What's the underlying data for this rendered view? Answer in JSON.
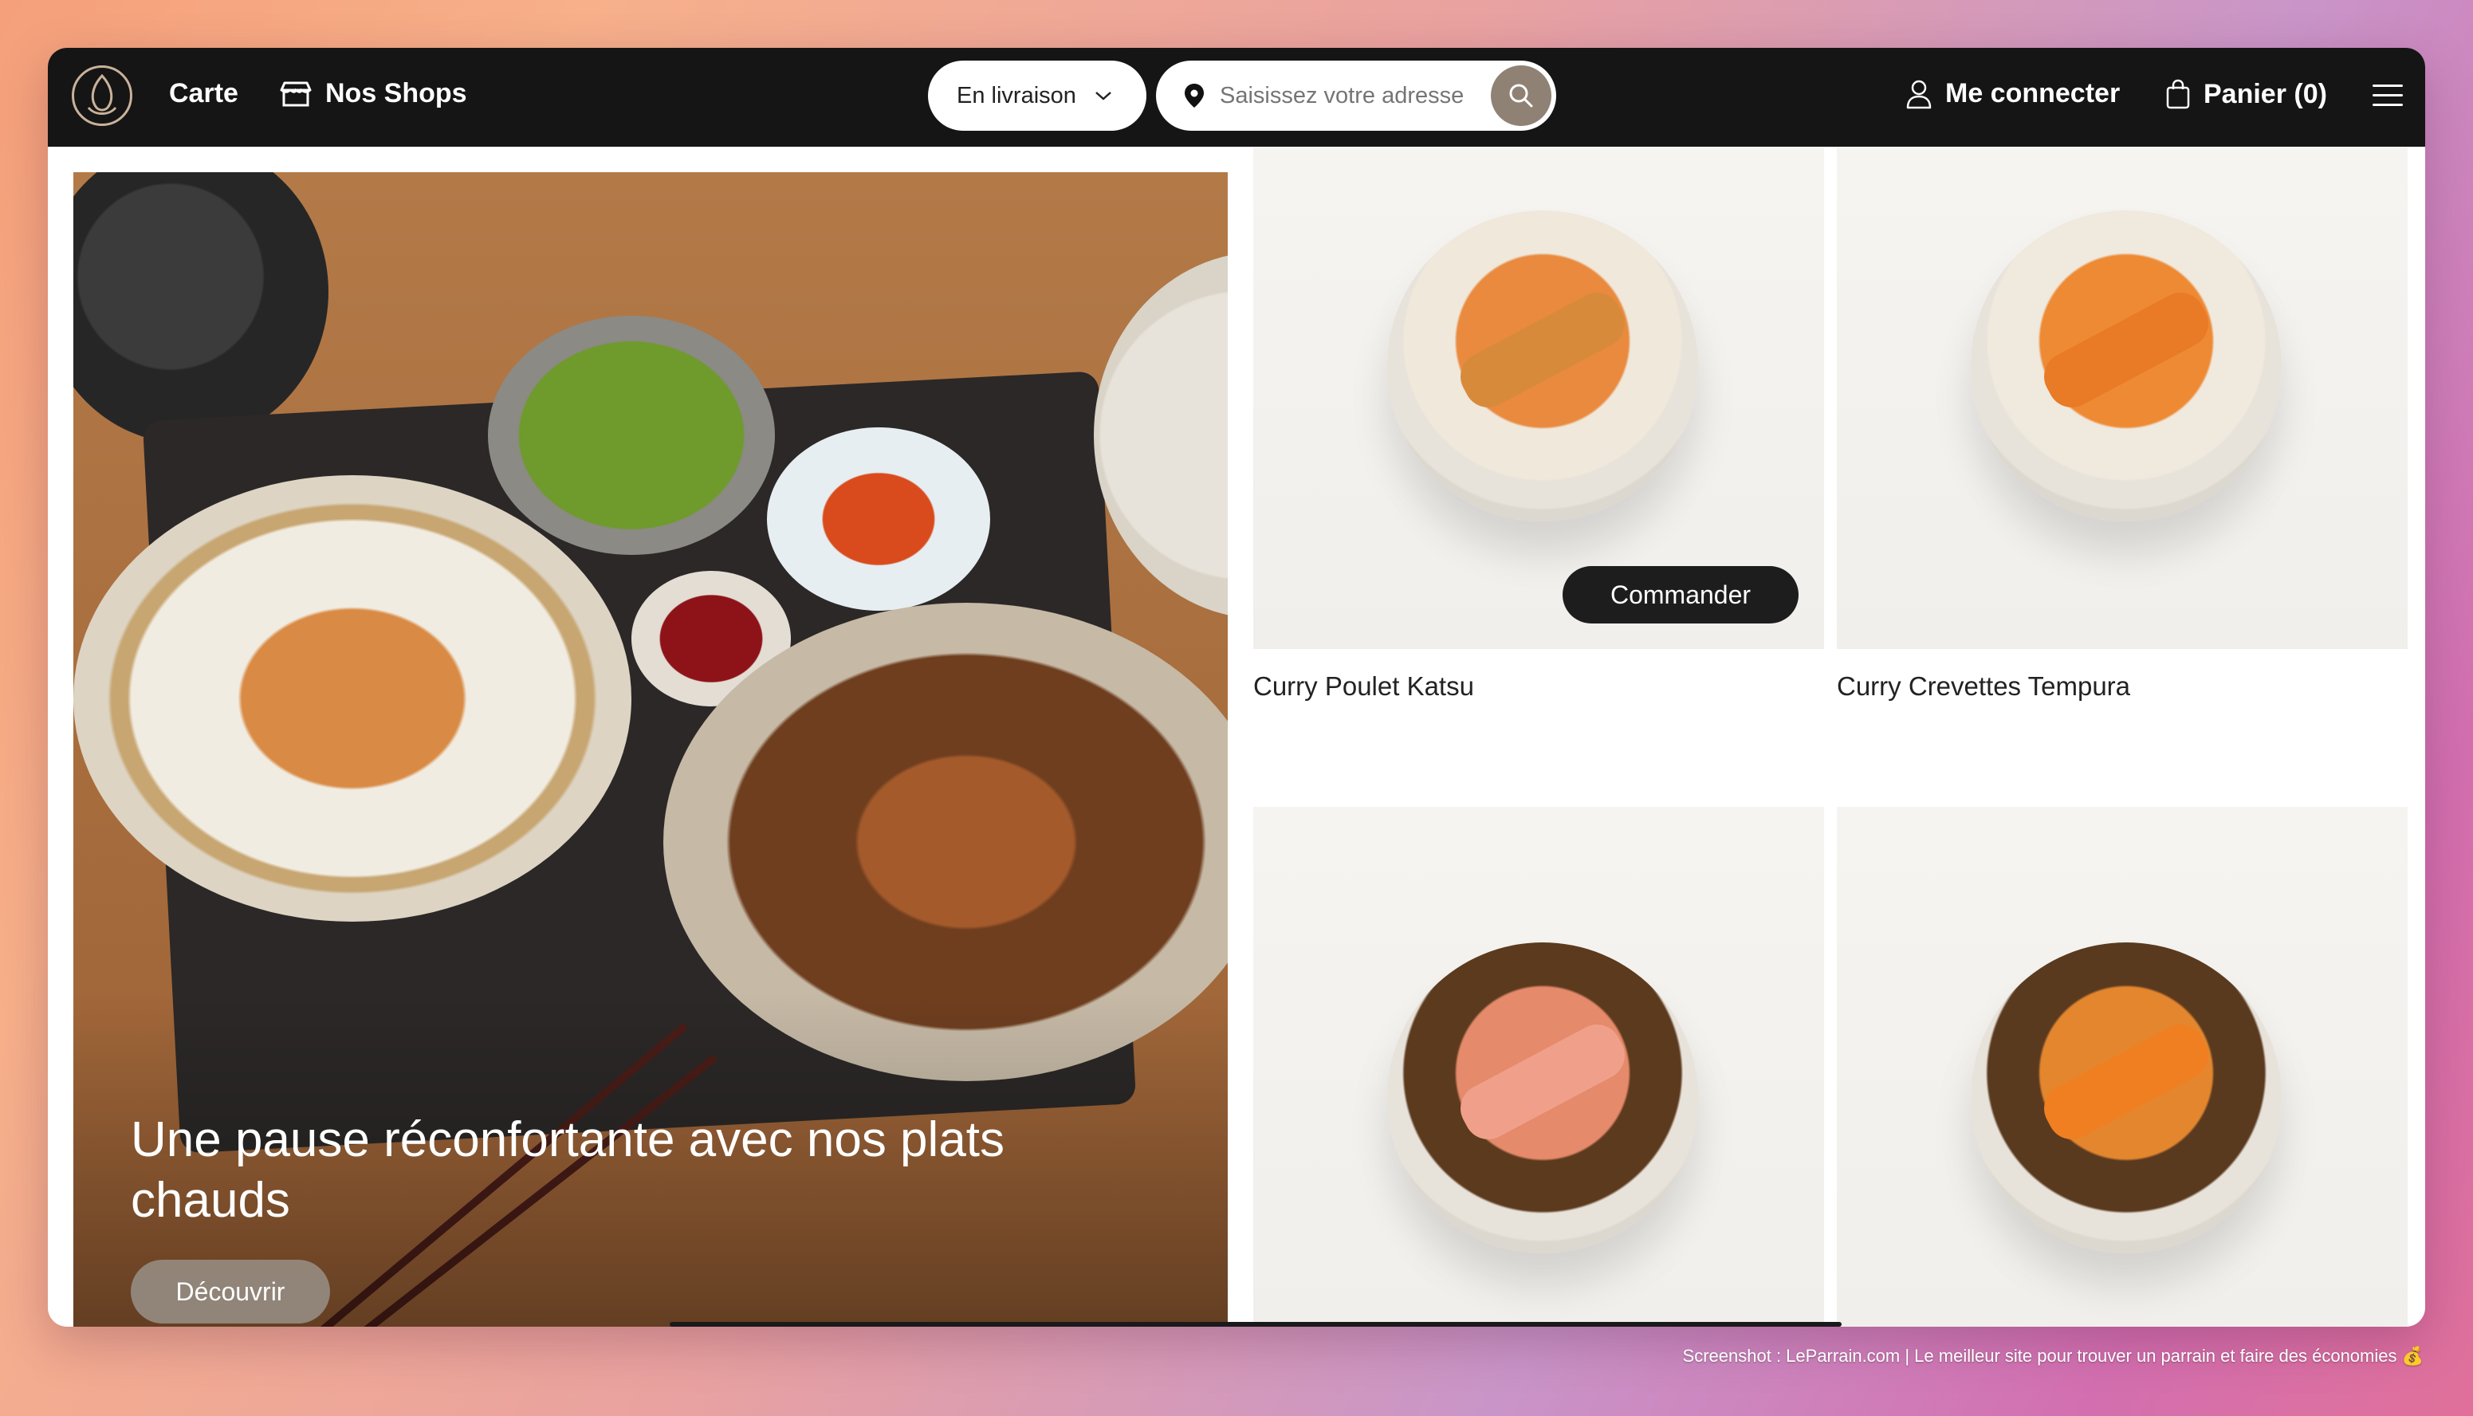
{
  "nav": {
    "menu_label": "Carte",
    "shops_label": "Nos Shops",
    "delivery_mode": "En livraison",
    "address_placeholder": "Saisissez votre adresse",
    "login_label": "Me connecter",
    "cart_label": "Panier (0)"
  },
  "hero": {
    "title": "Une pause réconfortante avec nos plats chauds",
    "button": "Découvrir"
  },
  "products": [
    {
      "name": "Curry Poulet Katsu",
      "action": "Commander"
    },
    {
      "name": "Curry Crevettes Tempura"
    },
    {
      "name": ""
    },
    {
      "name": ""
    }
  ],
  "colors": {
    "nav_bg": "#151515",
    "accent_button": "#1d1d1d",
    "hero_button": "#968c82"
  },
  "watermark": "Screenshot : LeParrain.com | Le meilleur site pour trouver un parrain et faire des économies 💰"
}
